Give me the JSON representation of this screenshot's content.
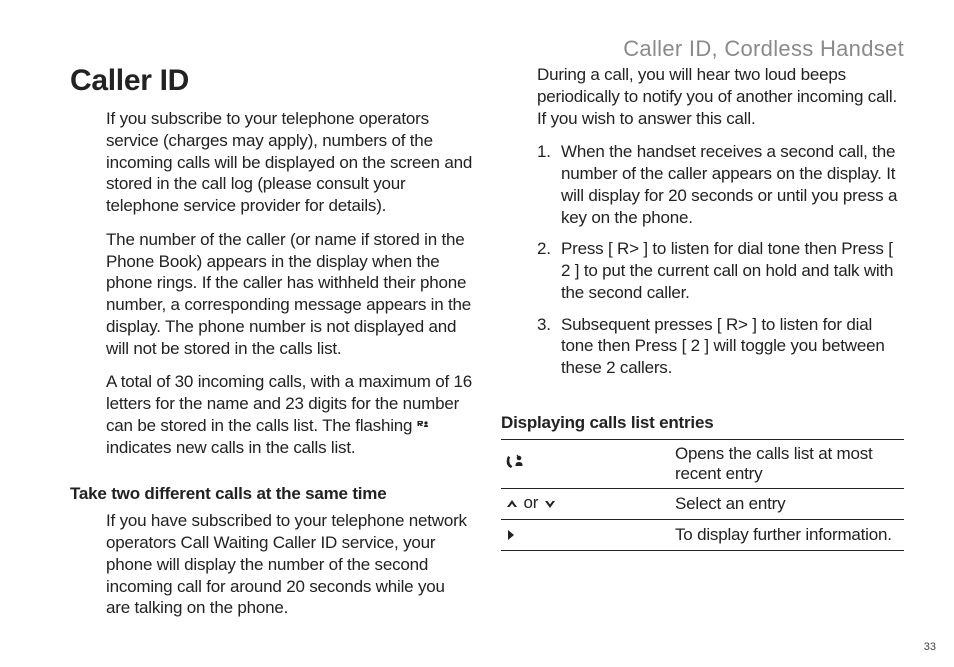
{
  "running_header": "Caller ID, Cordless Handset",
  "page_number": "33",
  "left": {
    "h1": "Caller ID",
    "p1": "If you subscribe to your telephone operators service (charges may apply), numbers of the incoming calls will be displayed on the screen and stored in the call log (please consult your telephone service provider for details).",
    "p2": "The number of the caller (or name if stored in the Phone Book) appears in the display when the phone rings. If the caller has withheld their phone number, a corresponding message appears in the display. The phone number is not displayed and will not be stored in the calls list.",
    "p3a": "A total of 30 incoming calls, with a maximum of 16 letters for the name and 23 digits for the number can be stored in the calls list. The flashing ",
    "p3b": " indicates new calls in the calls list.",
    "sub1_title": "Take two different calls at the same time",
    "sub1_p": "If you have subscribed to your telephone network operators Call Waiting Caller ID service, your phone will display the number of the second incoming call for around 20 seconds while you are talking on the phone."
  },
  "right": {
    "lead": "During a call, you will hear two loud beeps periodically to notify you of another incoming call. If you wish to answer this call.",
    "steps": [
      "When the handset receives a second call, the number of the caller appears on the display. It will display for 20 seconds or until you press a key on the phone.",
      "Press [ R> ] to listen for dial tone then Press [ 2 ] to put the current call on hold and talk with the second caller.",
      "Subsequent presses [ R> ] to listen for dial tone then Press [ 2 ] will toggle you between these 2 callers."
    ],
    "sub2_title": "Displaying calls list entries",
    "table": {
      "row1": {
        "icon": "calls-list-icon",
        "desc": "Opens the calls list at most recent entry"
      },
      "row2": {
        "mid": " or ",
        "desc": "Select an entry"
      },
      "row3": {
        "desc": "To display further information."
      }
    }
  }
}
